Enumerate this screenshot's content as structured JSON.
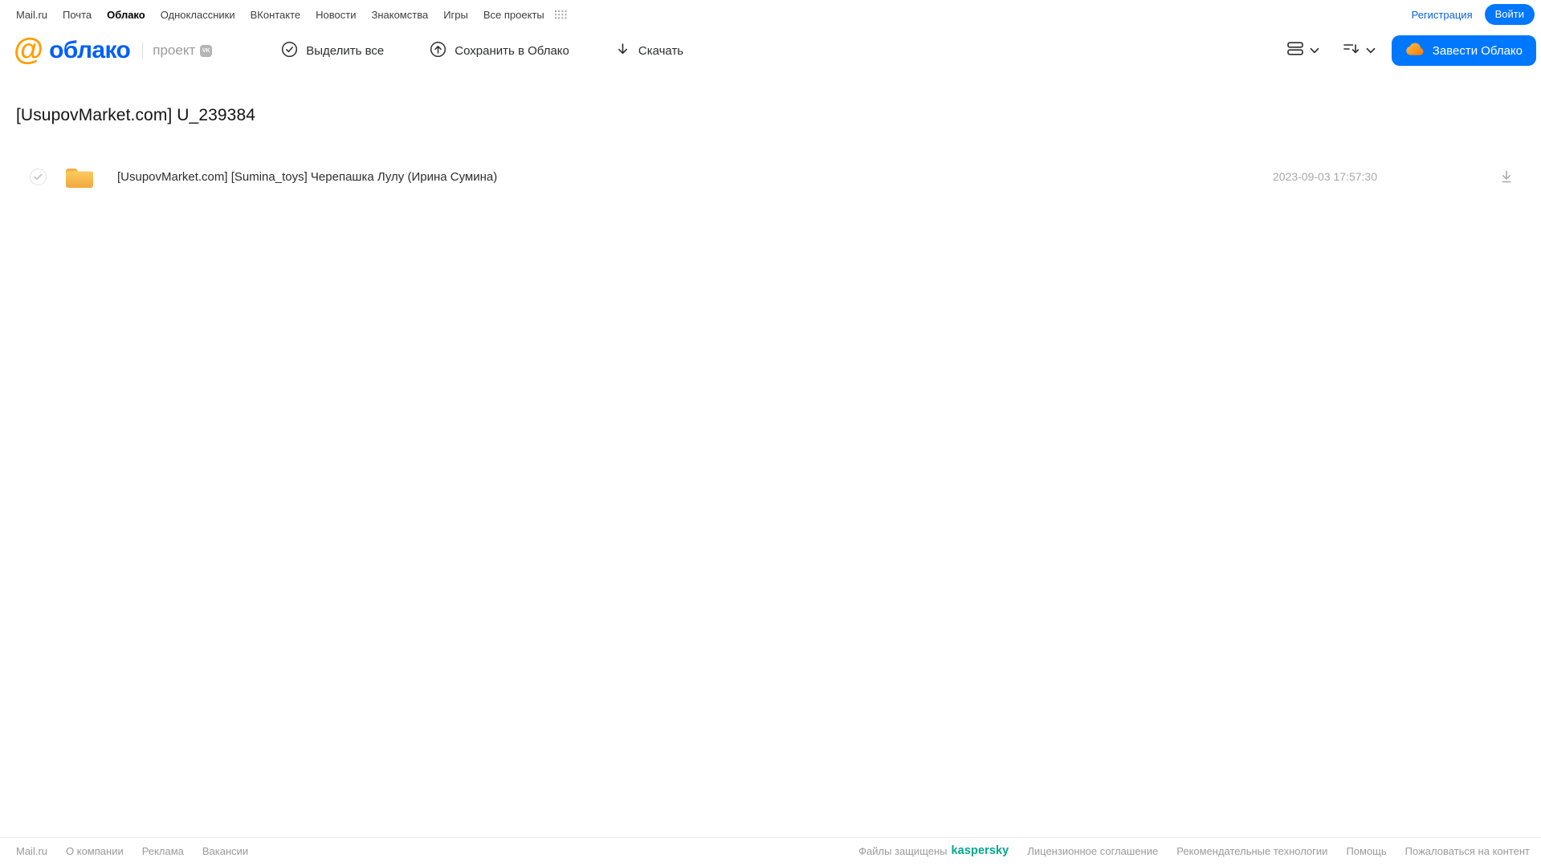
{
  "topbar": {
    "links": [
      "Mail.ru",
      "Почта",
      "Облако",
      "Одноклассники",
      "ВКонтакте",
      "Новости",
      "Знакомства",
      "Игры",
      "Все проекты"
    ],
    "active_link": "Облако",
    "registration_label": "Регистрация",
    "login_label": "Войти"
  },
  "header": {
    "logo_at": "@",
    "logo_text": "облако",
    "project_label": "проект",
    "vk_badge": "VK",
    "toolbar": {
      "select_all_label": "Выделить все",
      "save_to_cloud_label": "Сохранить в Облако",
      "download_label": "Скачать"
    },
    "cta_label": "Завести Облако"
  },
  "main": {
    "title": "[UsupovMarket.com] U_239384",
    "file": {
      "type": "folder",
      "name": "[UsupovMarket.com] [Sumina_toys] Черепашка Лулу (Ирина Сумина)",
      "modified": "2023-09-03 17:57:30"
    }
  },
  "footer": {
    "links_left": [
      "Mail.ru",
      "О компании",
      "Реклама",
      "Вакансии"
    ],
    "protected_prefix": "Файлы защищены",
    "kaspersky_label": "kaspersky",
    "links_right": [
      "Лицензионное соглашение",
      "Рекомендательные технологии",
      "Помощь",
      "Пожаловаться на контент"
    ]
  },
  "icons": {
    "apps-grid-icon": "dot-grid",
    "check-circle-icon": "✓ in circle",
    "cloud-upload-icon": "↑ in circle",
    "download-icon": "↓",
    "list-view-icon": "stacked rows",
    "sort-icon": "lines with ↓",
    "chevron-down-icon": "⌄",
    "cloud-icon": "orange cloud",
    "folder-icon": "yellow folder",
    "vk-badge-icon": "VK",
    "download-underline-icon": "↓ with baseline"
  },
  "colors": {
    "accent_blue": "#0077ff",
    "logo_orange": "#ff9e00",
    "logo_blue": "#005ff9",
    "folder_yellow": "#f5b64a",
    "kaspersky_green": "#00a88e",
    "muted_gray": "#9a9a9a"
  }
}
